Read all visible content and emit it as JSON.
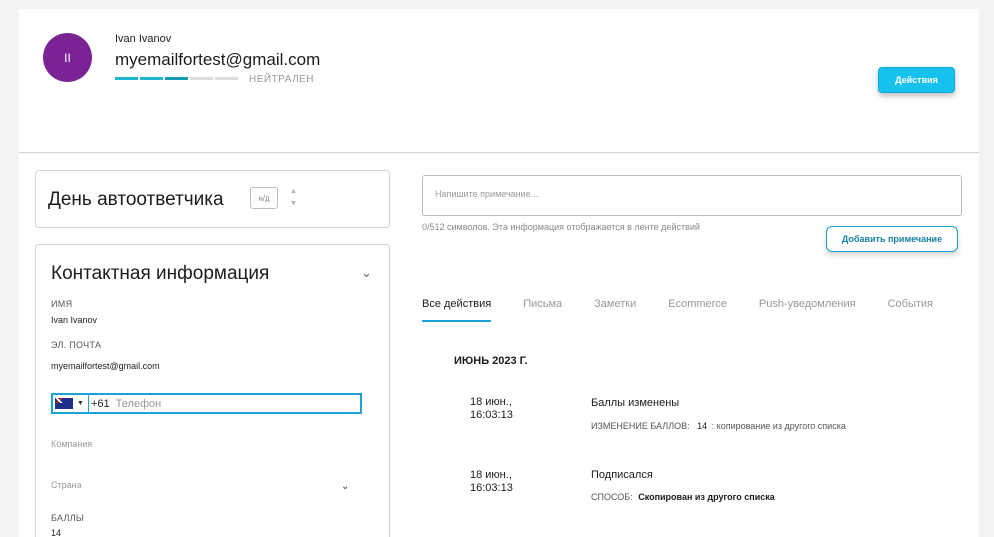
{
  "header": {
    "avatar_initials": "II",
    "name": "Ivan Ivanov",
    "email": "myemailfortest@gmail.com",
    "status": "НЕЙТРАЛЕН",
    "actions_label": "Действия",
    "progress_segments_on": 3,
    "progress_segments_total": 5
  },
  "autoresponder": {
    "title": "День автоответчика",
    "day_value": "н/д"
  },
  "contact": {
    "title": "Контактная информация",
    "name_label": "ИМЯ",
    "name_value": "Ivan Ivanov",
    "email_label": "ЭЛ. ПОЧТА",
    "email_value": "myemailfortest@gmail.com",
    "phone_code": "+61",
    "phone_placeholder": "Телефон",
    "company_placeholder": "Компания",
    "country_placeholder": "Страна",
    "score_label": "БАЛЛЫ",
    "score_value": "14"
  },
  "note": {
    "placeholder": "Напишите примечание...",
    "help": "0/512 символов. Эта информация отображается в ленте действий",
    "add_label": "Добавить примечание"
  },
  "tabs": [
    {
      "label": "Все действия",
      "active": true
    },
    {
      "label": "Письма",
      "active": false
    },
    {
      "label": "Заметки",
      "active": false
    },
    {
      "label": "Ecommerce",
      "active": false
    },
    {
      "label": "Push-уведомления",
      "active": false
    },
    {
      "label": "События",
      "active": false
    }
  ],
  "timeline": {
    "month": "ИЮНЬ 2023 Г.",
    "events": [
      {
        "date": "18 июн.,",
        "time": "16:03:13",
        "title": "Баллы изменены",
        "detail_label": "ИЗМЕНЕНИЕ БАЛЛОВ:",
        "detail_value": "14",
        "detail_suffix": ": копирование из другого списка"
      },
      {
        "date": "18 июн.,",
        "time": "16:03:13",
        "title": "Подписался",
        "detail_label": "СПОСОБ:",
        "detail_value": "Скопирован из другого списка"
      }
    ]
  }
}
